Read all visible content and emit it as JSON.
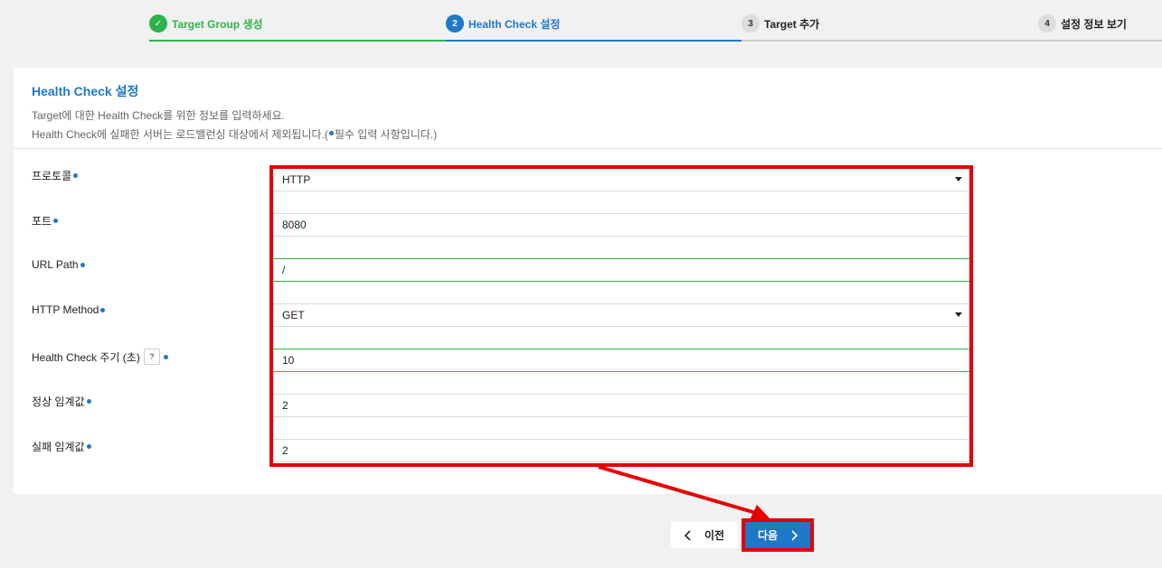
{
  "stepper": {
    "steps": [
      {
        "num": "✓",
        "label": "Target Group 생성"
      },
      {
        "num": "2",
        "label": "Health Check 설정"
      },
      {
        "num": "3",
        "label": "Target 추가"
      },
      {
        "num": "4",
        "label": "설정 정보 보기"
      }
    ]
  },
  "panel": {
    "title": "Health Check 설정",
    "desc1": "Target에 대한 Health Check를 위한 정보를 입력하세요.",
    "desc2_a": "Health Check에 실패한 서버는 로드밸런싱 대상에서 제외됩니다.(",
    "desc2_b": "필수 입력 사항입니다.)"
  },
  "form": {
    "protocol": {
      "label": "프로토콜",
      "value": "HTTP"
    },
    "port": {
      "label": "포트",
      "value": "8080"
    },
    "url_path": {
      "label": "URL Path",
      "value": "/"
    },
    "http_method": {
      "label": "HTTP Method",
      "value": "GET"
    },
    "interval": {
      "label": "Health Check 주기 (초)",
      "value": "10"
    },
    "healthy_threshold": {
      "label": "정상 임계값",
      "value": "2"
    },
    "unhealthy_threshold": {
      "label": "실패 임계값",
      "value": "2"
    }
  },
  "buttons": {
    "prev": "이전",
    "next": "다음"
  },
  "colors": {
    "accent": "#1e78c8",
    "done": "#2db34a",
    "highlight": "#e60000"
  }
}
